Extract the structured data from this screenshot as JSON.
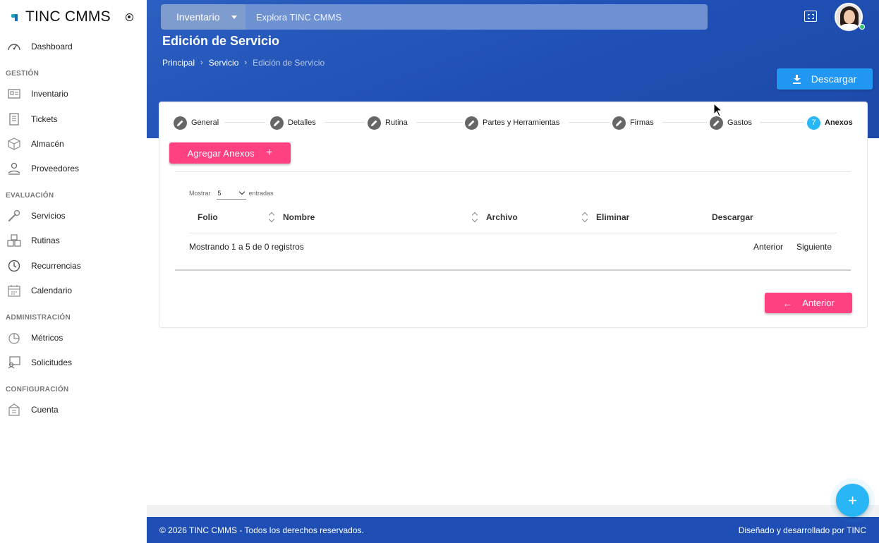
{
  "brand": {
    "title": "TINC CMMS"
  },
  "sidebar": {
    "items": [
      {
        "label": "Dashboard",
        "icon": "speedometer-icon"
      },
      {
        "section": "GESTIÓN"
      },
      {
        "label": "Inventario",
        "icon": "inventory-icon"
      },
      {
        "label": "Tickets",
        "icon": "ticket-icon"
      },
      {
        "label": "Almacén",
        "icon": "box-icon"
      },
      {
        "label": "Proveedores",
        "icon": "supplier-icon"
      },
      {
        "section": "EVALUACIÓN"
      },
      {
        "label": "Servicios",
        "icon": "wrench-icon"
      },
      {
        "label": "Rutinas",
        "icon": "boxes-icon"
      },
      {
        "label": "Recurrencias",
        "icon": "clock-icon"
      },
      {
        "label": "Calendario",
        "icon": "calendar-icon"
      },
      {
        "section": "ADMINISTRACIÓN"
      },
      {
        "label": "Métricos",
        "icon": "metrics-icon"
      },
      {
        "label": "Solicitudes",
        "icon": "requests-icon"
      },
      {
        "section": "CONFIGURACIÓN"
      },
      {
        "label": "Cuenta",
        "icon": "account-icon"
      }
    ]
  },
  "header": {
    "search_category": "Inventario",
    "search_placeholder": "Explora TINC CMMS",
    "page_title": "Edición de Servicio",
    "breadcrumb": [
      "Principal",
      "Servicio",
      "Edición de Servicio"
    ],
    "download_label": "Descargar"
  },
  "stepper": {
    "steps": [
      {
        "label": "General",
        "state": "edit"
      },
      {
        "label": "Detalles",
        "state": "edit"
      },
      {
        "label": "Rutina",
        "state": "edit"
      },
      {
        "label": "Partes y Herramientas",
        "state": "edit"
      },
      {
        "label": "Firmas",
        "state": "edit"
      },
      {
        "label": "Gastos",
        "state": "edit"
      },
      {
        "label": "Anexos",
        "state": "active",
        "number": "7"
      }
    ]
  },
  "annexes": {
    "add_label": "Agregar Anexos",
    "show_label": "Mostrar",
    "page_size": "5",
    "entries_label": "entradas",
    "columns": [
      "Folio",
      "Nombre",
      "Archivo",
      "Eliminar",
      "Descargar"
    ],
    "info": "Mostrando 1 a 5 de 0 registros",
    "prev_label": "Anterior",
    "next_label": "Siguiente",
    "back_label": "Anterior"
  },
  "footer": {
    "left": "© 2026 TINC CMMS - Todos los derechos reservados.",
    "right": "Diseñado y desarrollado por TINC"
  },
  "colors": {
    "primary": "#1f4fb4",
    "accent": "#ff4081",
    "info": "#29b6f6",
    "download": "#2196f3"
  }
}
